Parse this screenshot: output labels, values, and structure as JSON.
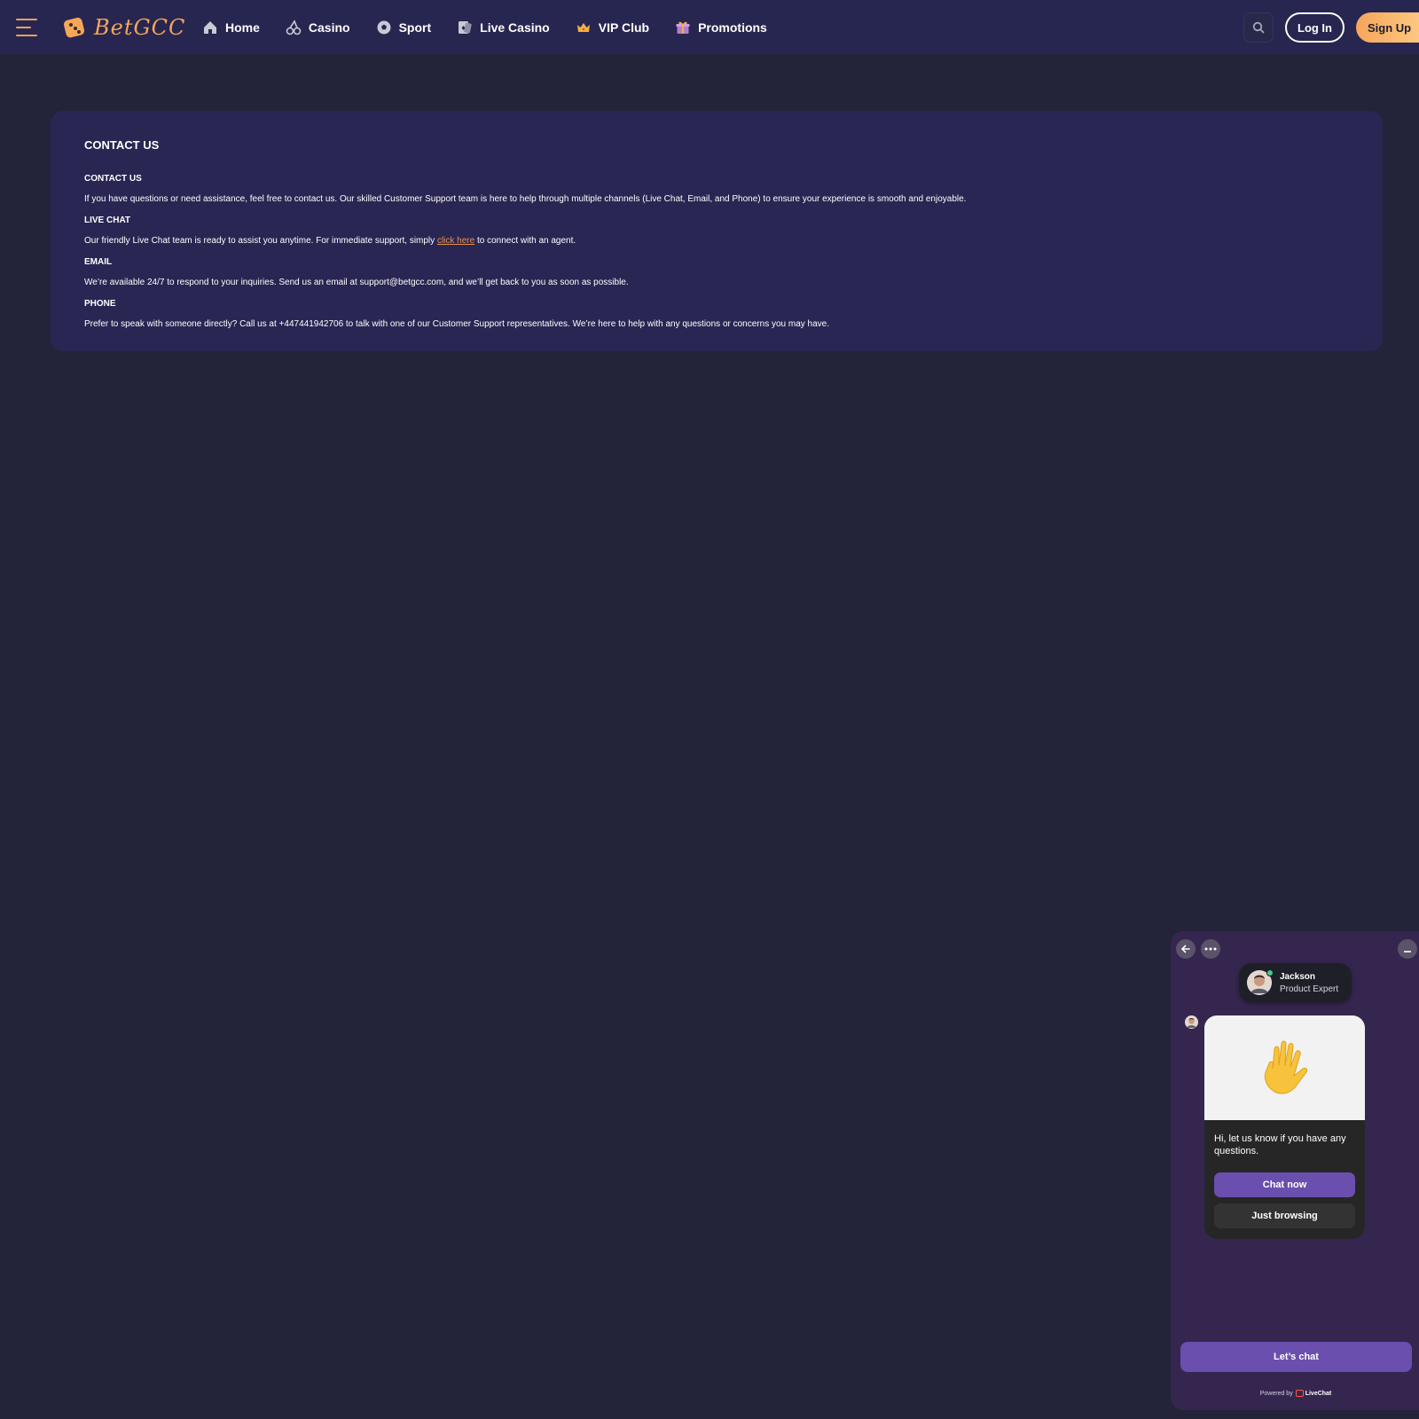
{
  "header": {
    "logo_text": "BetGCC",
    "nav": [
      {
        "label": "Home",
        "icon": "home-icon"
      },
      {
        "label": "Casino",
        "icon": "cherry-icon"
      },
      {
        "label": "Sport",
        "icon": "soccer-ball-icon"
      },
      {
        "label": "Live Casino",
        "icon": "playing-card-icon"
      },
      {
        "label": "VIP Club",
        "icon": "crown-icon"
      },
      {
        "label": "Promotions",
        "icon": "gift-icon"
      }
    ],
    "login_label": "Log In",
    "signup_label": "Sign Up"
  },
  "content": {
    "page_title": "CONTACT US",
    "sections": [
      {
        "heading": "CONTACT US",
        "text": "If you have questions or need assistance, feel free to contact us. Our skilled Customer Support team is here to help through multiple channels (Live Chat, Email, and Phone) to ensure your experience is smooth and enjoyable."
      },
      {
        "heading": "LIVE CHAT",
        "text_before": "Our friendly Live Chat team is ready to assist you anytime. For immediate support, simply ",
        "link": "click here",
        "text_after": " to connect with an agent."
      },
      {
        "heading": "EMAIL",
        "text": "We’re available 24/7 to respond to your inquiries. Send us an email at support@betgcc.com, and we’ll get back to you as soon as possible."
      },
      {
        "heading": "PHONE",
        "text": "Prefer to speak with someone directly? Call us at +447441942706 to talk with one of our Customer Support representatives. We’re here to help with any questions or concerns you may have."
      }
    ]
  },
  "chat": {
    "agent_name": "Jackson",
    "agent_role": "Product Expert",
    "message": "Hi, let us know if you have any questions.",
    "chat_now_label": "Chat now",
    "just_browsing_label": "Just browsing",
    "lets_chat_label": "Let’s chat",
    "powered_by": "Powered by",
    "brand": "LiveChat"
  },
  "colors": {
    "page_bg": "#23233a",
    "header_bg": "#272650",
    "card_bg": "#292653",
    "accent_orange": "#f5a65a",
    "chat_purple": "#6a4fae",
    "chat_panel_bg": "#35264f"
  }
}
